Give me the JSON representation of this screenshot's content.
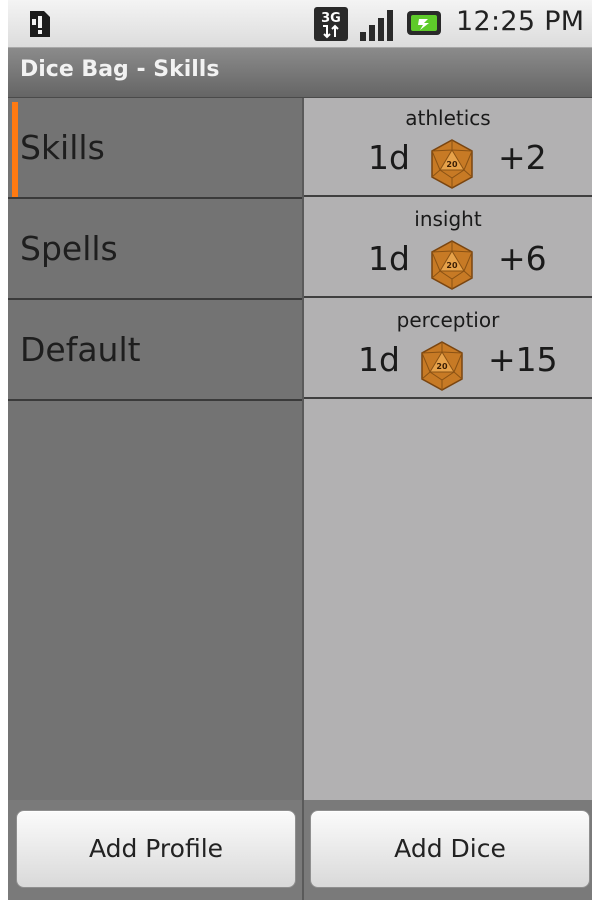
{
  "status_bar": {
    "clock": "12:25 PM",
    "network_label": "3G",
    "icons": [
      "sim-alert-icon",
      "3g-data-icon",
      "signal-strength-icon",
      "battery-charging-icon"
    ]
  },
  "app": {
    "title": "Dice Bag - Skills"
  },
  "profiles": {
    "items": [
      {
        "label": "Skills",
        "selected": true
      },
      {
        "label": "Spells",
        "selected": false
      },
      {
        "label": "Default",
        "selected": false
      }
    ],
    "add_button": "Add Profile"
  },
  "dice": {
    "die_icon_number": "20",
    "items": [
      {
        "name": "athletics",
        "count": "1d",
        "modifier": "+2"
      },
      {
        "name": "insight",
        "count": "1d",
        "modifier": "+6"
      },
      {
        "name": "perceptior",
        "count": "1d",
        "modifier": "+15"
      }
    ],
    "add_button": "Add Dice"
  },
  "colors": {
    "accent_selection": "#ff7a12",
    "left_panel": "#737373",
    "right_panel": "#b2b1b2",
    "title_bar": "#787878",
    "die_orange": "#d58a2e"
  }
}
